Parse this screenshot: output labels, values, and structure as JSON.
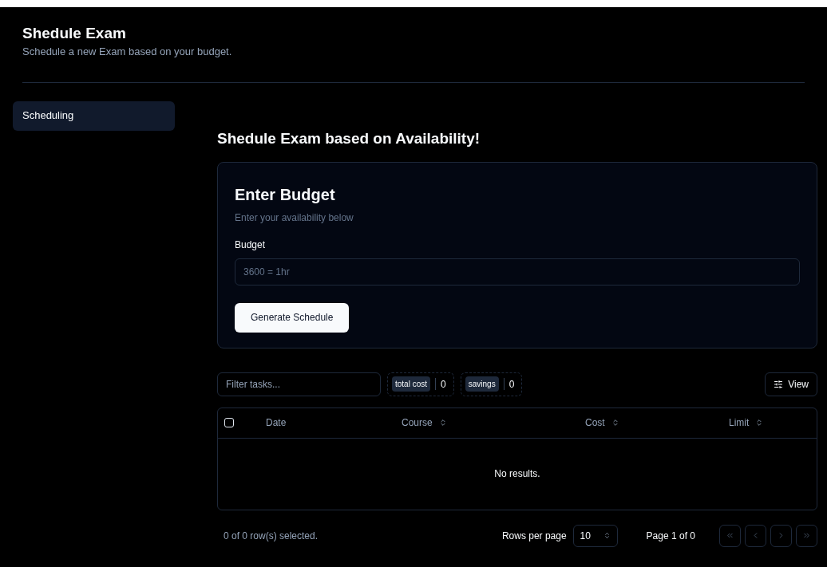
{
  "header": {
    "title": "Shedule Exam",
    "subtitle": "Schedule a new Exam based on your budget."
  },
  "sidebar": {
    "items": [
      {
        "label": "Scheduling",
        "selected": true
      }
    ]
  },
  "main": {
    "heading": "Shedule Exam based on Availability!",
    "card": {
      "title": "Enter Budget",
      "description": "Enter your availability below",
      "field_label": "Budget",
      "placeholder": "3600 = 1hr",
      "button": "Generate Schedule"
    },
    "toolbar": {
      "filter_placeholder": "Filter tasks...",
      "stats": [
        {
          "label": "total cost",
          "value": "0"
        },
        {
          "label": "savings",
          "value": "0"
        }
      ],
      "view_button": "View"
    },
    "table": {
      "select_all_checked": false,
      "columns": [
        {
          "label": "Date",
          "sortable": false
        },
        {
          "label": "Course",
          "sortable": true
        },
        {
          "label": "Cost",
          "sortable": true
        },
        {
          "label": "Limit",
          "sortable": true
        }
      ],
      "empty_text": "No results."
    },
    "footer": {
      "selection": "0 of 0 row(s) selected.",
      "rows_label": "Rows per page",
      "rows_value": "10",
      "page": "Page 1 of 0",
      "pager": [
        {
          "kind": "first",
          "disabled": true
        },
        {
          "kind": "prev",
          "disabled": true
        },
        {
          "kind": "next",
          "disabled": true
        },
        {
          "kind": "last",
          "disabled": true
        }
      ]
    }
  }
}
